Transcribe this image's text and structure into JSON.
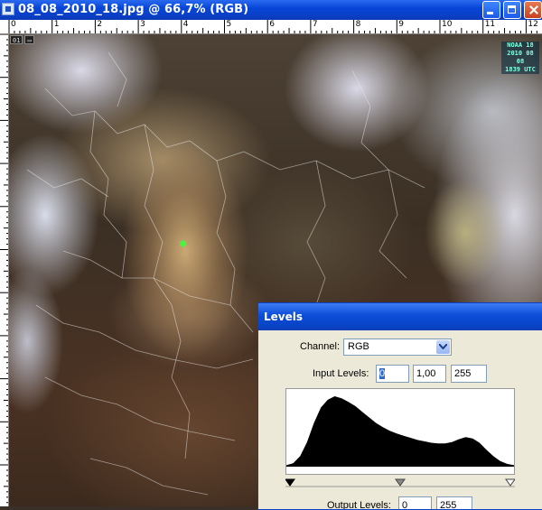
{
  "window": {
    "title": "08_08_2010_18.jpg @ 66,7% (RGB)"
  },
  "ruler": {
    "labels": [
      "0",
      "1",
      "2",
      "3",
      "4",
      "5",
      "6",
      "7",
      "8",
      "9",
      "10",
      "11",
      "12"
    ]
  },
  "image": {
    "frame_badge": [
      "01",
      "▭"
    ],
    "stamp_lines": [
      "NOAA 18",
      "2010 08 08",
      "1839 UTC"
    ]
  },
  "levels": {
    "title": "Levels",
    "channel_label": "Channel:",
    "channel_value": "RGB",
    "input_label": "Input Levels:",
    "input_black": "0",
    "input_gamma": "1,00",
    "input_white": "255",
    "output_label": "Output Levels:",
    "output_black": "0",
    "output_white": "255",
    "histogram_shape": [
      0.02,
      0.05,
      0.15,
      0.35,
      0.62,
      0.84,
      0.95,
      1.0,
      0.97,
      0.92,
      0.86,
      0.78,
      0.7,
      0.62,
      0.56,
      0.51,
      0.47,
      0.44,
      0.41,
      0.38,
      0.36,
      0.34,
      0.33,
      0.33,
      0.35,
      0.39,
      0.42,
      0.4,
      0.34,
      0.24,
      0.15,
      0.08,
      0.04,
      0.02
    ]
  }
}
